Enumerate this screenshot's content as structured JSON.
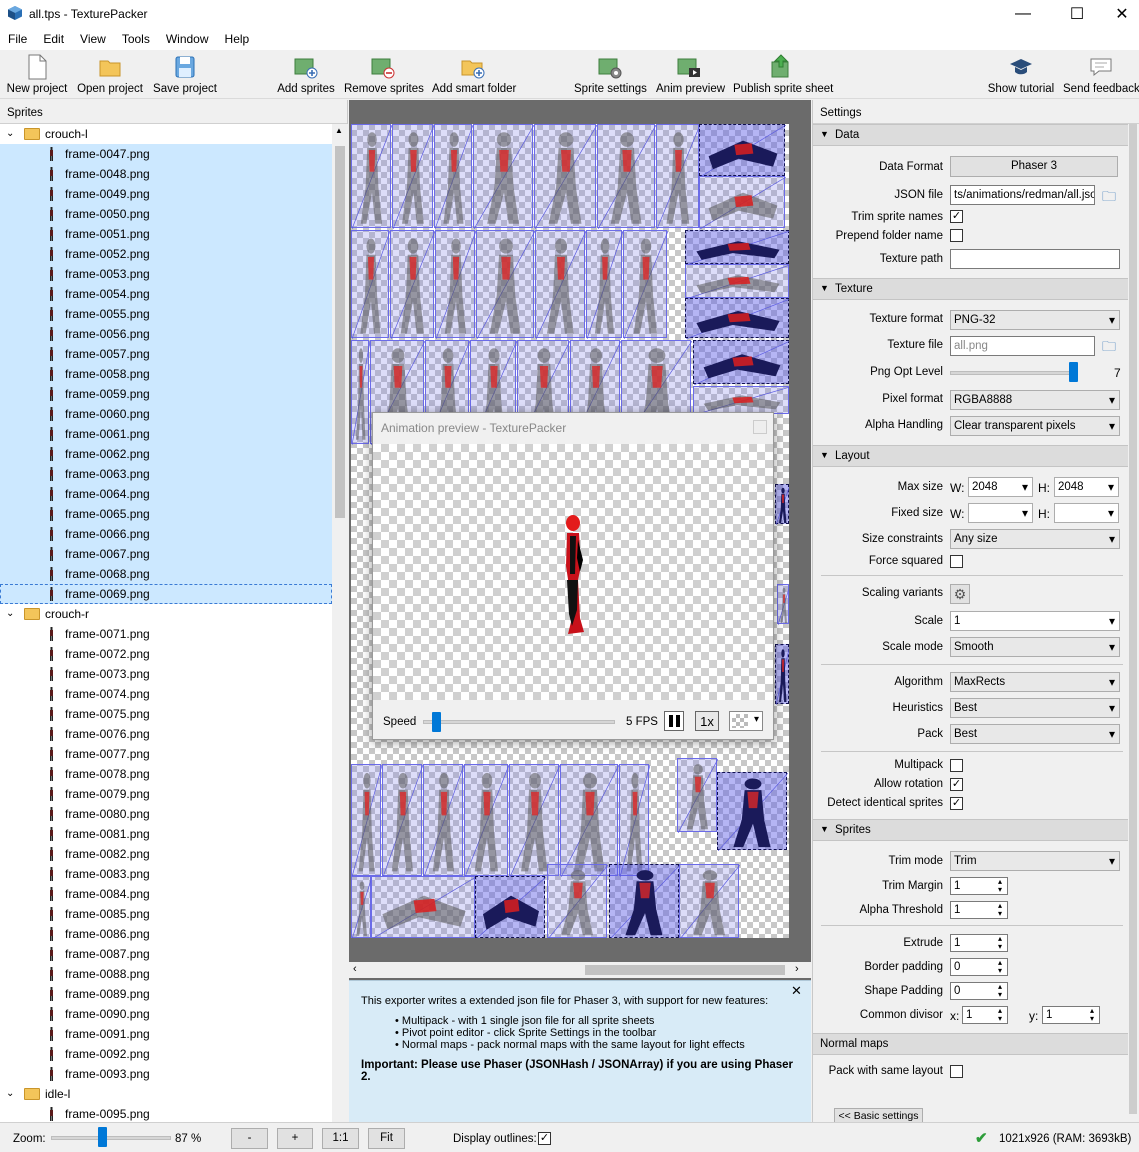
{
  "window": {
    "title": "all.tps - TexturePacker",
    "min": "—",
    "max": "☐",
    "close": "✕"
  },
  "menu": [
    "File",
    "Edit",
    "View",
    "Tools",
    "Window",
    "Help"
  ],
  "toolbar": {
    "new_project": "New project",
    "open_project": "Open project",
    "save_project": "Save project",
    "add_sprites": "Add sprites",
    "remove_sprites": "Remove sprites",
    "add_smart_folder": "Add smart folder",
    "sprite_settings": "Sprite settings",
    "anim_preview": "Anim preview",
    "publish": "Publish sprite sheet",
    "show_tutorial": "Show tutorial",
    "send_feedback": "Send feedback"
  },
  "sprites_panel": {
    "header": "Sprites",
    "groups": [
      {
        "name": "crouch-l",
        "selected": true,
        "items": [
          "frame-0047.png",
          "frame-0048.png",
          "frame-0049.png",
          "frame-0050.png",
          "frame-0051.png",
          "frame-0052.png",
          "frame-0053.png",
          "frame-0054.png",
          "frame-0055.png",
          "frame-0056.png",
          "frame-0057.png",
          "frame-0058.png",
          "frame-0059.png",
          "frame-0060.png",
          "frame-0061.png",
          "frame-0062.png",
          "frame-0063.png",
          "frame-0064.png",
          "frame-0065.png",
          "frame-0066.png",
          "frame-0067.png",
          "frame-0068.png",
          "frame-0069.png"
        ]
      },
      {
        "name": "crouch-r",
        "selected": false,
        "items": [
          "frame-0071.png",
          "frame-0072.png",
          "frame-0073.png",
          "frame-0074.png",
          "frame-0075.png",
          "frame-0076.png",
          "frame-0077.png",
          "frame-0078.png",
          "frame-0079.png",
          "frame-0080.png",
          "frame-0081.png",
          "frame-0082.png",
          "frame-0083.png",
          "frame-0084.png",
          "frame-0085.png",
          "frame-0086.png",
          "frame-0087.png",
          "frame-0088.png",
          "frame-0089.png",
          "frame-0090.png",
          "frame-0091.png",
          "frame-0092.png",
          "frame-0093.png"
        ]
      },
      {
        "name": "idle-l",
        "selected": false,
        "items": [
          "frame-0095.png"
        ]
      }
    ]
  },
  "preview": {
    "title": "Animation preview - TexturePacker",
    "speed_label": "Speed",
    "speed_value": 0.05,
    "fps": "5 FPS",
    "rate": "1x"
  },
  "info": {
    "line1": "This exporter writes a extended json file for Phaser 3, with support for new features:",
    "bullets": [
      "Multipack - with 1 single json file for all sprite sheets",
      "Pivot point editor - click Sprite Settings in the toolbar",
      "Normal maps - pack normal maps with the same layout for light effects"
    ],
    "important": "Important: Please use Phaser (JSONHash / JSONArray) if you are using Phaser 2."
  },
  "settings": {
    "header": "Settings",
    "data": {
      "title": "Data",
      "data_format_label": "Data Format",
      "data_format": "Phaser 3",
      "json_file_label": "JSON file",
      "json_file": "ts/animations/redman/all.json",
      "trim_names_label": "Trim sprite names",
      "prepend_label": "Prepend folder name",
      "texture_path_label": "Texture path",
      "texture_path": ""
    },
    "texture": {
      "title": "Texture",
      "format_label": "Texture format",
      "format": "PNG-32",
      "file_label": "Texture file",
      "file": "all.png",
      "png_opt_label": "Png Opt Level",
      "png_opt": "7",
      "png_opt_fraction": 1.0,
      "pixel_label": "Pixel format",
      "pixel": "RGBA8888",
      "alpha_label": "Alpha Handling",
      "alpha": "Clear transparent pixels"
    },
    "layout": {
      "title": "Layout",
      "max_size_label": "Max size",
      "w": "W:",
      "h": "H:",
      "max_w": "2048",
      "max_h": "2048",
      "fixed_label": "Fixed size",
      "constraints_label": "Size constraints",
      "constraints": "Any size",
      "force_sq_label": "Force squared",
      "scaling_label": "Scaling variants",
      "scale_label": "Scale",
      "scale": "1",
      "scale_mode_label": "Scale mode",
      "scale_mode": "Smooth",
      "algorithm_label": "Algorithm",
      "algorithm": "MaxRects",
      "heuristics_label": "Heuristics",
      "heuristics": "Best",
      "pack_label": "Pack",
      "pack": "Best",
      "multipack_label": "Multipack",
      "rotation_label": "Allow rotation",
      "identical_label": "Detect identical sprites"
    },
    "sprites": {
      "title": "Sprites",
      "trim_mode_label": "Trim mode",
      "trim_mode": "Trim",
      "trim_margin_label": "Trim Margin",
      "trim_margin": "1",
      "alpha_thr_label": "Alpha Threshold",
      "alpha_thr": "1",
      "extrude_label": "Extrude",
      "extrude": "1",
      "border_label": "Border padding",
      "border": "0",
      "shape_label": "Shape Padding",
      "shape": "0",
      "divisor_label": "Common divisor",
      "x": "x:",
      "y": "y:",
      "div_x": "1",
      "div_y": "1"
    },
    "normal": {
      "title": "Normal maps",
      "same_layout_label": "Pack with same layout"
    },
    "basic_btn": "<< Basic settings"
  },
  "status": {
    "zoom_label": "Zoom:",
    "zoom": "87 %",
    "zoom_fraction": 0.42,
    "minus": "-",
    "plus": "+",
    "one": "1:1",
    "fit": "Fit",
    "outlines_label": "Display outlines:",
    "size": "1021x926 (RAM: 3693kB)"
  },
  "check": "✓"
}
